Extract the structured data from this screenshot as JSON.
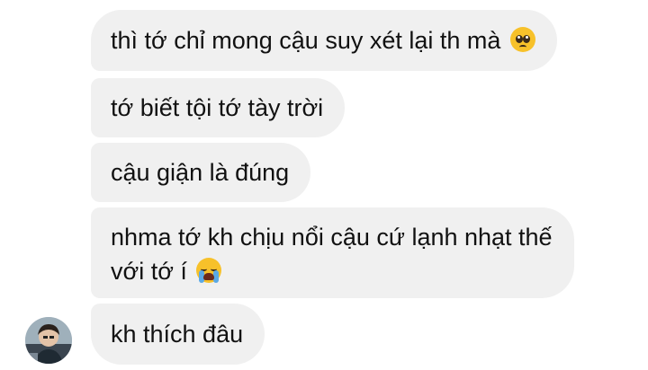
{
  "messages": [
    {
      "text": "thì tớ chỉ mong cậu suy xét lại th mà",
      "emoji": "pleading-face-icon"
    },
    {
      "text": "tớ biết tội tớ tày trời"
    },
    {
      "text": "cậu giận là đúng"
    },
    {
      "line1": "nhma tớ kh chịu nổi cậu cứ lạnh nhạt thế",
      "line2": "với tớ í",
      "emoji": "loudly-crying-face-icon"
    },
    {
      "text": "kh thích đâu"
    }
  ],
  "colors": {
    "bubble": "#f0f0f0",
    "text": "#111111",
    "background": "#ffffff"
  }
}
